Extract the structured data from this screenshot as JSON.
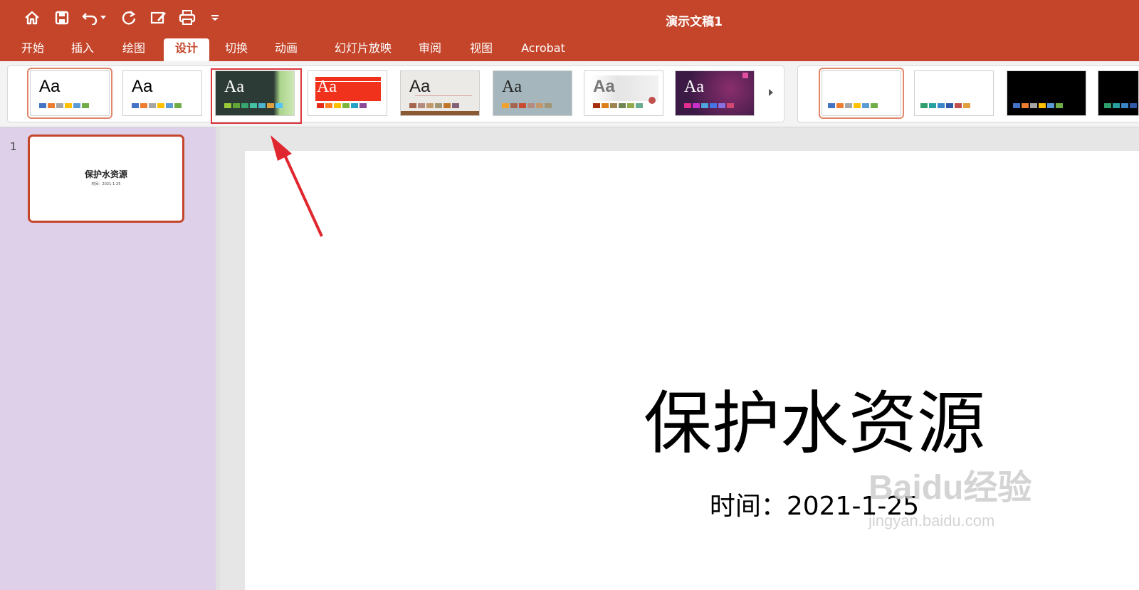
{
  "titlebar": {
    "doc_title": "演示文稿1",
    "icons": [
      "home-icon",
      "save-icon",
      "undo-icon",
      "undo-dropdown-icon",
      "redo-icon",
      "edit-icon",
      "print-icon",
      "customize-dropdown-icon"
    ]
  },
  "tabs": [
    {
      "label": "开始"
    },
    {
      "label": "插入"
    },
    {
      "label": "绘图"
    },
    {
      "label": "设计",
      "active": true
    },
    {
      "label": "切换"
    },
    {
      "label": "动画"
    },
    {
      "label": "幻灯片放映"
    },
    {
      "label": "审阅"
    },
    {
      "label": "视图"
    },
    {
      "label": "Acrobat"
    }
  ],
  "themes": [
    {
      "aa": "Aa",
      "selected": true,
      "bg": "#ffffff",
      "color": "#000000"
    },
    {
      "aa": "Aa",
      "bg": "#ffffff",
      "color": "#000000"
    },
    {
      "aa": "Aa",
      "bg": "#2c3b35",
      "color": "#ffffff",
      "highlighted": true
    },
    {
      "aa": "Aa",
      "bg": "#ffffff",
      "color": "#ffffff",
      "band": "#f0321c"
    },
    {
      "aa": "Aa",
      "bg": "#eceae6",
      "color": "#222222"
    },
    {
      "aa": "Aa",
      "bg": "#a6b6bd",
      "color": "#222222"
    },
    {
      "aa": "Aa",
      "bg": "#ffffff",
      "color": "#777777"
    },
    {
      "aa": "Aa",
      "bg": "#4a1f4e",
      "color": "#ffffff"
    }
  ],
  "colors": {
    "accent": "#c4452a",
    "pane": "#ddd0e8",
    "highlight": "#d9363e"
  },
  "slides": [
    {
      "number": "1",
      "title": "保护水资源",
      "subtitle": "时间：2021-1-25"
    }
  ],
  "slide": {
    "title": "保护水资源",
    "subtitle": "时间：2021-1-25"
  },
  "watermark": {
    "logo": "Baidu经验",
    "url": "jingyan.baidu.com"
  }
}
